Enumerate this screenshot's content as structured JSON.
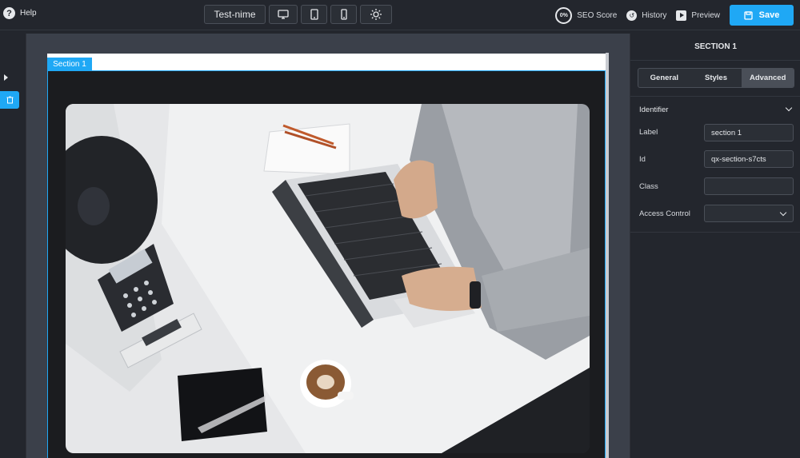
{
  "topbar": {
    "help_label": "Help",
    "page_title": "Test-nime",
    "seo_percent": "0%",
    "seo_label": "SEO Score",
    "history_label": "History",
    "preview_label": "Preview",
    "save_label": "Save"
  },
  "canvas": {
    "section_tag": "Section 1"
  },
  "panel": {
    "title": "SECTION 1",
    "tabs": [
      {
        "label": "General",
        "active": false
      },
      {
        "label": "Styles",
        "active": false
      },
      {
        "label": "Advanced",
        "active": true
      }
    ],
    "group_title": "Identifier",
    "fields": {
      "label": {
        "name": "Label",
        "value": "section 1"
      },
      "id": {
        "name": "Id",
        "value": "qx-section-s7cts"
      },
      "class": {
        "name": "Class",
        "value": ""
      },
      "access": {
        "name": "Access Control",
        "value": ""
      }
    }
  },
  "colors": {
    "accent": "#1fa8f5",
    "background": "#23262d",
    "canvas": "#3b404a"
  }
}
